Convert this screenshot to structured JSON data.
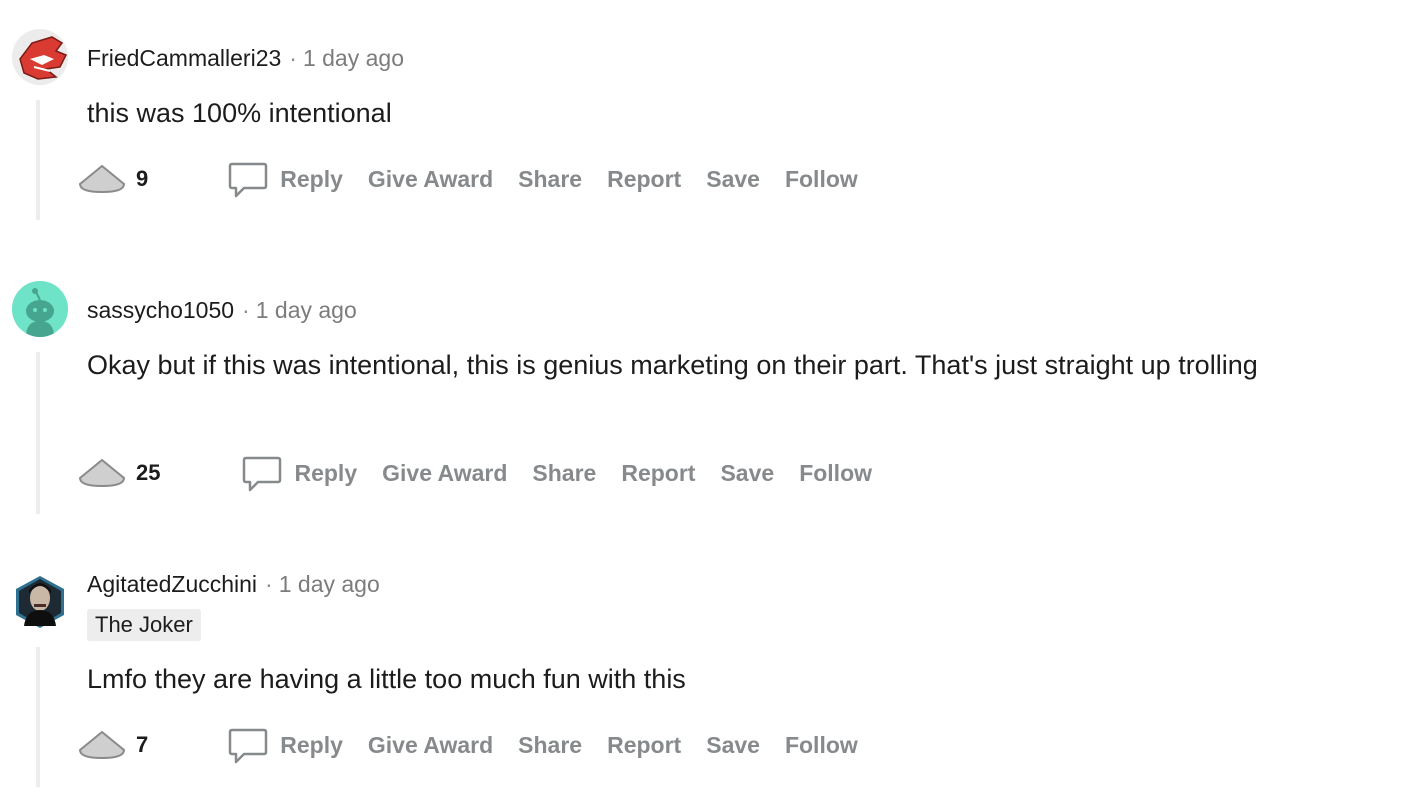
{
  "comments": [
    {
      "username": "FriedCammalleri23",
      "separator": "·",
      "time": "1 day ago",
      "flair": "",
      "body": "this was 100% intentional",
      "votes": "9",
      "actions": {
        "reply": "Reply",
        "give_award": "Give Award",
        "share": "Share",
        "report": "Report",
        "save": "Save",
        "follow": "Follow"
      },
      "avatar_icon": "red-helmet-avatar-icon"
    },
    {
      "username": "sassycho1050",
      "separator": "·",
      "time": "1 day ago",
      "flair": "",
      "body": "Okay but if this was intentional, this is genius marketing on their part. That's just straight up trolling",
      "votes": "25",
      "actions": {
        "reply": "Reply",
        "give_award": "Give Award",
        "share": "Share",
        "report": "Report",
        "save": "Save",
        "follow": "Follow"
      },
      "avatar_icon": "snoo-avatar-icon"
    },
    {
      "username": "AgitatedZucchini",
      "separator": "·",
      "time": "1 day ago",
      "flair": "The Joker",
      "body": "Lmfo they are having a little too much fun with this",
      "votes": "7",
      "actions": {
        "reply": "Reply",
        "give_award": "Give Award",
        "share": "Share",
        "report": "Report",
        "save": "Save",
        "follow": "Follow"
      },
      "avatar_icon": "joker-avatar-icon"
    }
  ],
  "colors": {
    "text": "#1c1c1c",
    "meta": "#7c7c7c",
    "action": "#878a8c",
    "thread_line": "#ededed",
    "flair_bg": "#ededed",
    "avatar2_bg": "#6fe3c7",
    "avatar1_accent": "#d93a32"
  }
}
